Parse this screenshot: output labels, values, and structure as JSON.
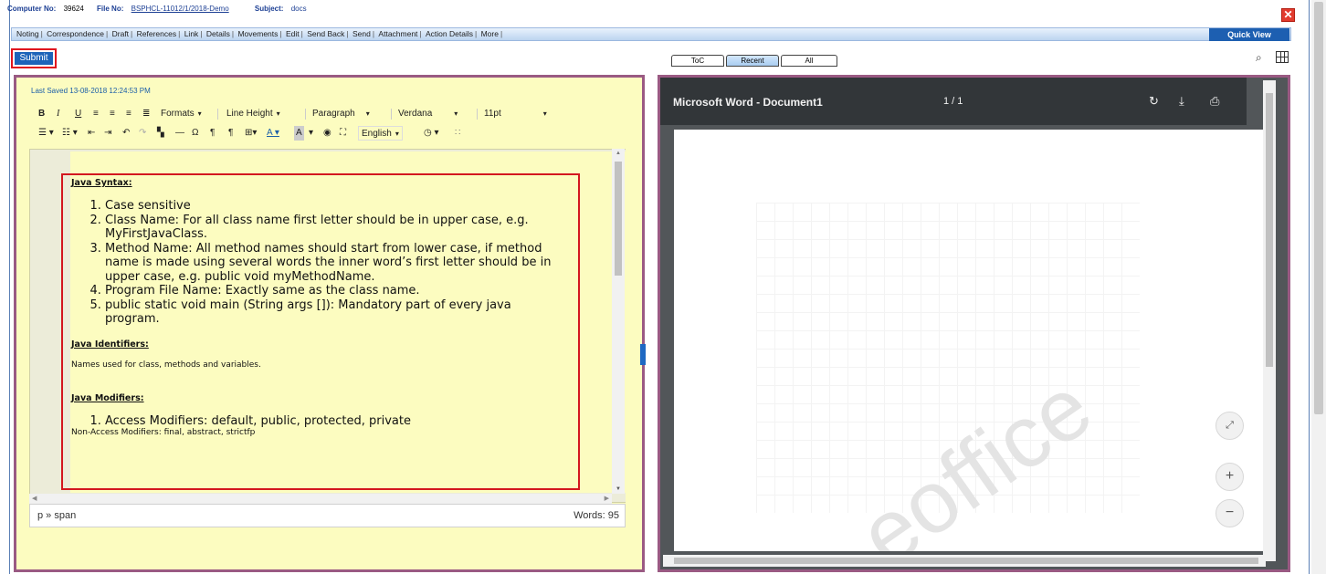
{
  "header": {
    "computer_no_label": "Computer No:",
    "computer_no": "39624",
    "file_no_label": "File No:",
    "file_no": "BSPHCL-11012/1/2018-Demo",
    "subject_label": "Subject:",
    "subject": "docs",
    "close_symbol": "✕"
  },
  "menu": {
    "items": [
      "Noting",
      "Correspondence",
      "Draft",
      "References",
      "Link",
      "Details",
      "Movements",
      "Edit",
      "Send Back",
      "Send",
      "Attachment",
      "Action Details",
      "More"
    ],
    "quick_view": "Quick View"
  },
  "actions": {
    "submit": "Submit"
  },
  "viewer_tabs": [
    "ToC",
    "Recent",
    "All"
  ],
  "editor": {
    "last_saved": "Last Saved 13-08-2018 12:24:53 PM",
    "toolbar": {
      "formats": "Formats",
      "line_height": "Line Height",
      "block": "Paragraph",
      "font": "Verdana",
      "size": "11pt",
      "language": "English"
    },
    "content": {
      "heading1": "Java Syntax:",
      "list1": [
        "Case sensitive",
        "Class Name: For all class name first letter should be in upper case, e.g. MyFirstJavaClass.",
        "Method Name: All method names should start from lower case, if method name is made using several words the inner word’s first letter should be in upper case, e.g. public void myMethodName.",
        "Program File Name: Exactly same as the class name.",
        "public static void main (String args []): Mandatory part of every java program."
      ],
      "heading2": "Java Identifiers:",
      "para2": "Names used for class, methods and variables.",
      "heading3": "Java Modifiers:",
      "list3": [
        "Access Modifiers: default, public, protected, private"
      ],
      "para3": "Non-Access Modifiers: final, abstract, strictfp"
    },
    "status_path": "p » span",
    "word_count": "Words: 95"
  },
  "viewer": {
    "title": "Microsoft Word - Document1",
    "page_indicator": "1 / 1",
    "watermark": "eoffice",
    "buttons": {
      "fit": "⤢",
      "zoom_in": "+",
      "zoom_out": "−"
    }
  }
}
